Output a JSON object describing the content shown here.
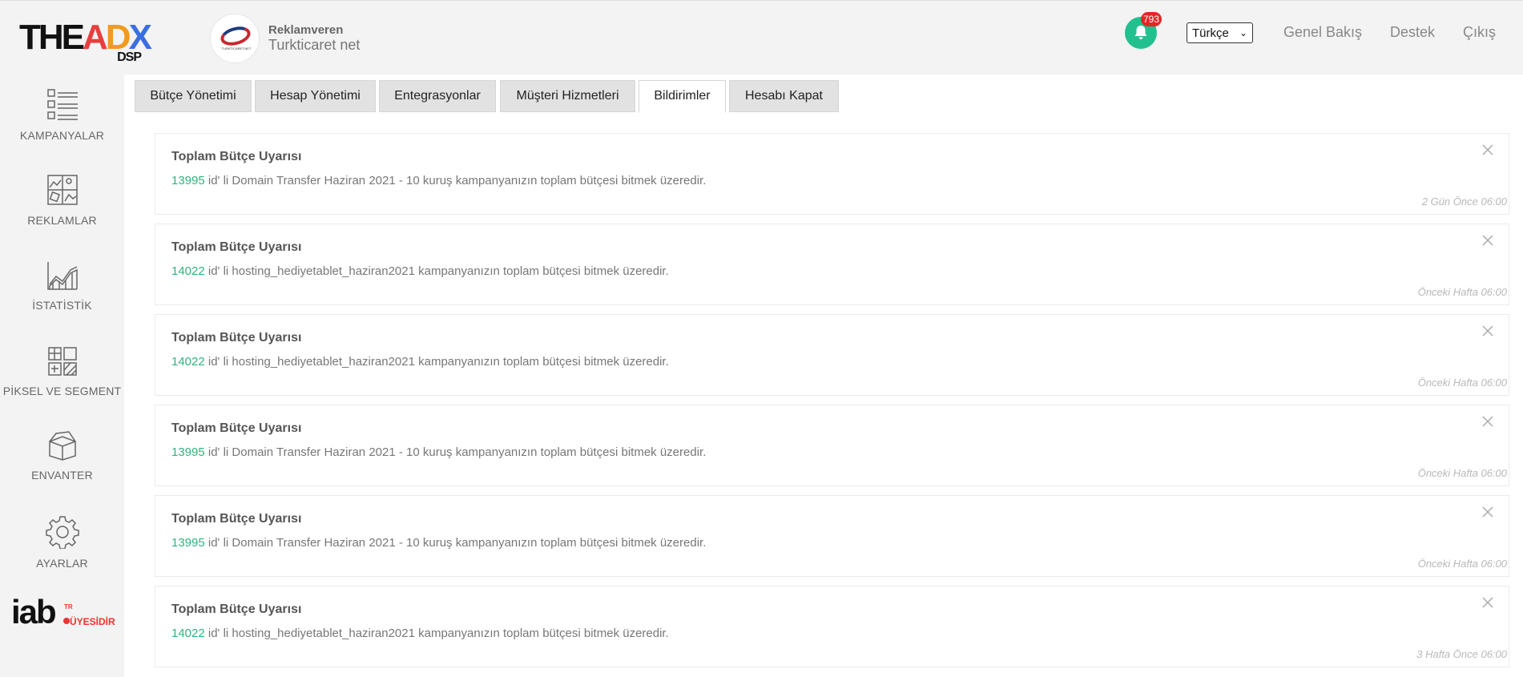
{
  "brand": {
    "logo_main": "THEADX",
    "logo_sub": "DSP"
  },
  "advertiser": {
    "label": "Reklamveren",
    "name": "Turkticaret net",
    "logo_caption": "TURKTICARET.NET"
  },
  "notifications": {
    "count": "793"
  },
  "language": {
    "selected": "Türkçe"
  },
  "topnav": {
    "overview": "Genel Bakış",
    "support": "Destek",
    "logout": "Çıkış"
  },
  "sidebar": {
    "items": [
      {
        "label": "KAMPANYALAR",
        "icon": "list-icon"
      },
      {
        "label": "REKLAMLAR",
        "icon": "image-grid-icon"
      },
      {
        "label": "İSTATİSTİK",
        "icon": "chart-icon"
      },
      {
        "label": "PİKSEL VE SEGMENT",
        "icon": "pixel-segment-icon"
      },
      {
        "label": "ENVANTER",
        "icon": "box-icon"
      },
      {
        "label": "AYARLAR",
        "icon": "gear-icon"
      }
    ],
    "iab": {
      "word": "iab",
      "country": "TR",
      "member_text": "ÜYESİDİR"
    }
  },
  "tabs": [
    {
      "label": "Bütçe Yönetimi",
      "active": false
    },
    {
      "label": "Hesap Yönetimi",
      "active": false
    },
    {
      "label": "Entegrasyonlar",
      "active": false
    },
    {
      "label": "Müşteri Hizmetleri",
      "active": false
    },
    {
      "label": "Bildirimler",
      "active": true
    },
    {
      "label": "Hesabı Kapat",
      "active": false
    }
  ],
  "alerts": [
    {
      "title": "Toplam Bütçe Uyarısı",
      "id": "13995",
      "message": " id' li Domain Transfer Haziran 2021 - 10 kuruş kampanyanızın toplam bütçesi bitmek üzeredir.",
      "time": "2 Gün Önce 06:00"
    },
    {
      "title": "Toplam Bütçe Uyarısı",
      "id": "14022",
      "message": " id' li hosting_hediyetablet_haziran2021 kampanyanızın toplam bütçesi bitmek üzeredir.",
      "time": "Önceki Hafta 06:00"
    },
    {
      "title": "Toplam Bütçe Uyarısı",
      "id": "14022",
      "message": " id' li hosting_hediyetablet_haziran2021 kampanyanızın toplam bütçesi bitmek üzeredir.",
      "time": "Önceki Hafta 06:00"
    },
    {
      "title": "Toplam Bütçe Uyarısı",
      "id": "13995",
      "message": " id' li Domain Transfer Haziran 2021 - 10 kuruş kampanyanızın toplam bütçesi bitmek üzeredir.",
      "time": "Önceki Hafta 06:00"
    },
    {
      "title": "Toplam Bütçe Uyarısı",
      "id": "13995",
      "message": " id' li Domain Transfer Haziran 2021 - 10 kuruş kampanyanızın toplam bütçesi bitmek üzeredir.",
      "time": "Önceki Hafta 06:00"
    },
    {
      "title": "Toplam Bütçe Uyarısı",
      "id": "14022",
      "message": " id' li hosting_hediyetablet_haziran2021 kampanyanızın toplam bütçesi bitmek üzeredir.",
      "time": "3 Hafta Önce 06:00"
    }
  ],
  "colors": {
    "accent_green": "#22c08f",
    "id_green": "#2fb37e",
    "badge_red": "#e32626"
  }
}
